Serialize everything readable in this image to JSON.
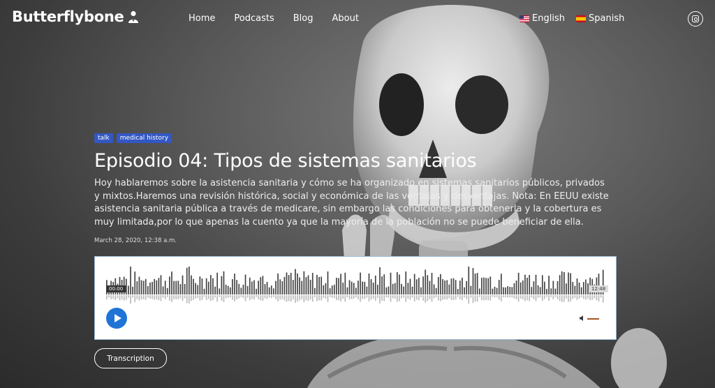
{
  "brand": {
    "name": "Butterflybone"
  },
  "nav": {
    "items": [
      {
        "label": "Home"
      },
      {
        "label": "Podcasts"
      },
      {
        "label": "Blog"
      },
      {
        "label": "About"
      }
    ]
  },
  "languages": [
    {
      "label": "English",
      "flag": "us-flag-icon"
    },
    {
      "label": "Spanish",
      "flag": "spain-flag-icon"
    }
  ],
  "social": {
    "icon": "instagram-icon"
  },
  "episode": {
    "tags": [
      "talk",
      "medical history"
    ],
    "title": "Episodio 04: Tipos de sistemas sanitarios",
    "description": "Hoy hablaremos sobre la asistencia sanitaria y cómo se ha organizado en sistemas sanitarios públicos, privados y mixtos.Haremos una revisión histórica, social y económica de las ventajas y desventajas. Nota: En EEUU existe asistencia sanitaria pública a través de medicare, sin embargo las condiciones para obtenerla y la cobertura es muy limitada,por lo que apenas la cuento ya que la mayoría de la población no se puede beneficiar de ella.",
    "date": "March 28, 2020, 12:38 a.m."
  },
  "player": {
    "current_time": "00:00",
    "duration": "12:48",
    "accent_color": "#1f74d6",
    "volume_color": "#a9541e"
  },
  "actions": {
    "transcription_label": "Transcription"
  }
}
